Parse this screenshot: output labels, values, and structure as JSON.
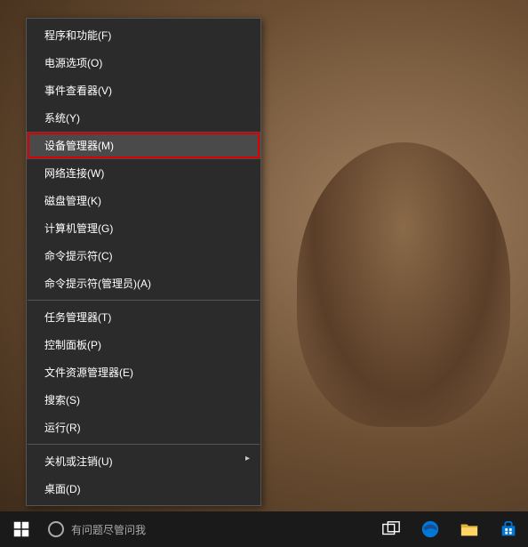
{
  "context_menu": {
    "items": [
      {
        "label": "程序和功能(F)",
        "highlighted": false,
        "separator_after": false
      },
      {
        "label": "电源选项(O)",
        "highlighted": false,
        "separator_after": false
      },
      {
        "label": "事件查看器(V)",
        "highlighted": false,
        "separator_after": false
      },
      {
        "label": "系统(Y)",
        "highlighted": false,
        "separator_after": false
      },
      {
        "label": "设备管理器(M)",
        "highlighted": true,
        "separator_after": false
      },
      {
        "label": "网络连接(W)",
        "highlighted": false,
        "separator_after": false
      },
      {
        "label": "磁盘管理(K)",
        "highlighted": false,
        "separator_after": false
      },
      {
        "label": "计算机管理(G)",
        "highlighted": false,
        "separator_after": false
      },
      {
        "label": "命令提示符(C)",
        "highlighted": false,
        "separator_after": false
      },
      {
        "label": "命令提示符(管理员)(A)",
        "highlighted": false,
        "separator_after": true
      },
      {
        "label": "任务管理器(T)",
        "highlighted": false,
        "separator_after": false
      },
      {
        "label": "控制面板(P)",
        "highlighted": false,
        "separator_after": false
      },
      {
        "label": "文件资源管理器(E)",
        "highlighted": false,
        "separator_after": false
      },
      {
        "label": "搜索(S)",
        "highlighted": false,
        "separator_after": false
      },
      {
        "label": "运行(R)",
        "highlighted": false,
        "separator_after": true
      },
      {
        "label": "关机或注销(U)",
        "highlighted": false,
        "has_submenu": true,
        "separator_after": false
      },
      {
        "label": "桌面(D)",
        "highlighted": false,
        "separator_after": false
      }
    ]
  },
  "taskbar": {
    "cortana_text": "有问题尽管问我"
  }
}
